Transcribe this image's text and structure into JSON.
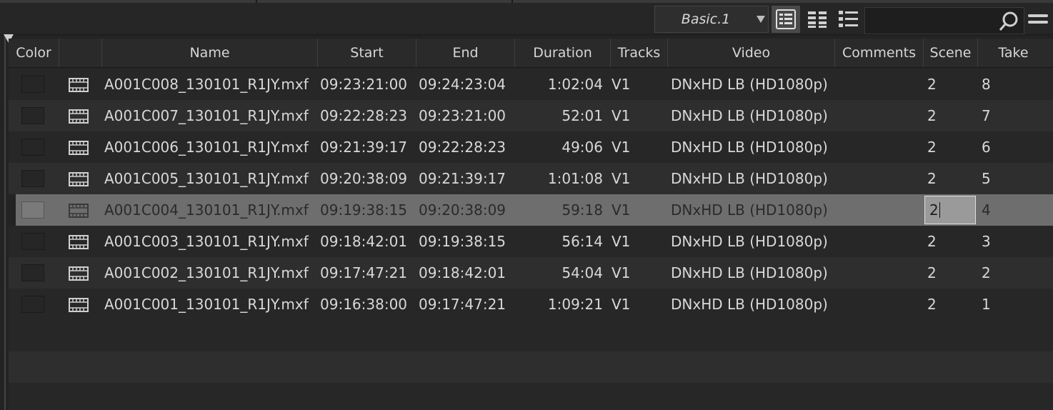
{
  "toolbar": {
    "view_name": "Basic.1",
    "view_buttons": [
      {
        "name": "frame-view",
        "active": true
      },
      {
        "name": "script-view",
        "active": false
      },
      {
        "name": "list-view",
        "active": false
      }
    ],
    "search_placeholder": ""
  },
  "columns": [
    "Color",
    "",
    "Name",
    "Start",
    "End",
    "Duration",
    "Tracks",
    "Video",
    "Comments",
    "Scene",
    "Take"
  ],
  "rows": [
    {
      "name": "A001C008_130101_R1JY.mxf",
      "start": "09:23:21:00",
      "end": "09:24:23:04",
      "duration": "1:02:04",
      "tracks": "V1",
      "video": "DNxHD LB (HD1080p)",
      "comments": "",
      "scene": "2",
      "take": "8"
    },
    {
      "name": "A001C007_130101_R1JY.mxf",
      "start": "09:22:28:23",
      "end": "09:23:21:00",
      "duration": "52:01",
      "tracks": "V1",
      "video": "DNxHD LB (HD1080p)",
      "comments": "",
      "scene": "2",
      "take": "7"
    },
    {
      "name": "A001C006_130101_R1JY.mxf",
      "start": "09:21:39:17",
      "end": "09:22:28:23",
      "duration": "49:06",
      "tracks": "V1",
      "video": "DNxHD LB (HD1080p)",
      "comments": "",
      "scene": "2",
      "take": "6"
    },
    {
      "name": "A001C005_130101_R1JY.mxf",
      "start": "09:20:38:09",
      "end": "09:21:39:17",
      "duration": "1:01:08",
      "tracks": "V1",
      "video": "DNxHD LB (HD1080p)",
      "comments": "",
      "scene": "2",
      "take": "5"
    },
    {
      "name": "A001C004_130101_R1JY.mxf",
      "start": "09:19:38:15",
      "end": "09:20:38:09",
      "duration": "59:18",
      "tracks": "V1",
      "video": "DNxHD LB (HD1080p)",
      "comments": "",
      "scene": "2",
      "take": "4",
      "selected": true
    },
    {
      "name": "A001C003_130101_R1JY.mxf",
      "start": "09:18:42:01",
      "end": "09:19:38:15",
      "duration": "56:14",
      "tracks": "V1",
      "video": "DNxHD LB (HD1080p)",
      "comments": "",
      "scene": "2",
      "take": "3"
    },
    {
      "name": "A001C002_130101_R1JY.mxf",
      "start": "09:17:47:21",
      "end": "09:18:42:01",
      "duration": "54:04",
      "tracks": "V1",
      "video": "DNxHD LB (HD1080p)",
      "comments": "",
      "scene": "2",
      "take": "2"
    },
    {
      "name": "A001C001_130101_R1JY.mxf",
      "start": "09:16:38:00",
      "end": "09:17:47:21",
      "duration": "1:09:21",
      "tracks": "V1",
      "video": "DNxHD LB (HD1080p)",
      "comments": "",
      "scene": "2",
      "take": "1"
    }
  ],
  "colors": {
    "background": "#232323",
    "header": "#2a2a2a",
    "row_odd": "#272727",
    "row_even": "#2e2e2e",
    "row_selected": "#6e6e6e",
    "text": "#d8d8d8"
  }
}
